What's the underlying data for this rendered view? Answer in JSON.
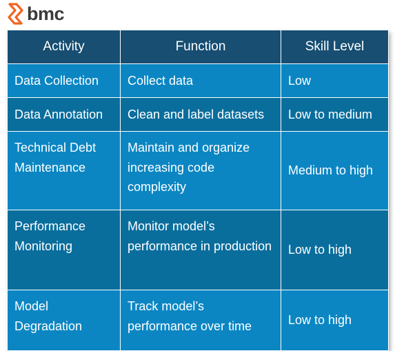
{
  "brand": {
    "logo_text": "bmc",
    "logo_icon": "bmc-chevron-icon",
    "accent_color": "#f26522"
  },
  "table": {
    "headers": [
      "Activity",
      "Function",
      "Skill Level"
    ],
    "rows": [
      {
        "activity": "Data Collection",
        "function": "Collect data",
        "skill": "Low"
      },
      {
        "activity": "Data Annotation",
        "function": "Clean and label datasets",
        "skill": "Low to medium"
      },
      {
        "activity": "Technical Debt Maintenance",
        "function": "Maintain and organize increasing code complexity",
        "skill": "Medium to high"
      },
      {
        "activity": "Performance Monitoring",
        "function": "Monitor model’s performance in production",
        "skill": "Low to high"
      },
      {
        "activity": "Model Degradation",
        "function": "Track model’s performance over time",
        "skill": "Low to high"
      }
    ]
  },
  "colors": {
    "header_bg": "#174e72",
    "row_light": "#0b86c3",
    "row_dark": "#0a6e9d",
    "text": "#ffffff"
  }
}
